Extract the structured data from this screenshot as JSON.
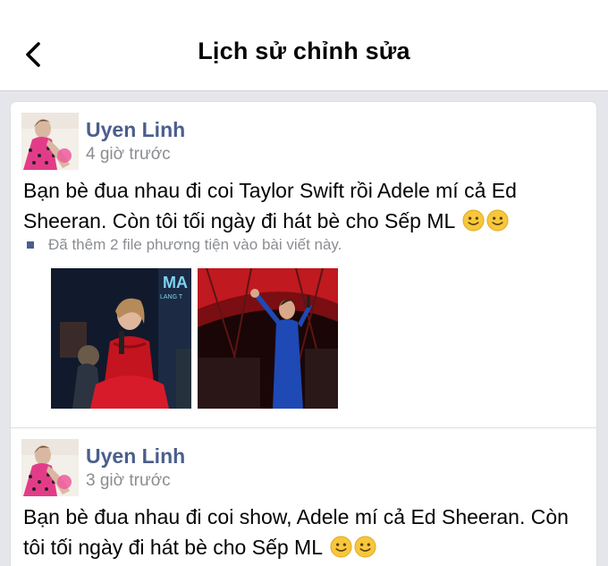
{
  "header": {
    "title": "Lịch sử chỉnh sửa",
    "back_icon": "chevron-left-icon"
  },
  "colors": {
    "author_name": "#4b5e8c",
    "meta_text": "#8a8d91",
    "background": "#e4e6eb"
  },
  "revisions": [
    {
      "author": "Uyen Linh",
      "time": "4 giờ trước",
      "text": "Bạn bè đua nhau đi coi Taylor Swift rồi Adele mí cả Ed Sheeran. Còn tôi tối ngày đi hát bè cho Sếp ML",
      "emojis": [
        "slightly-smiling-face-icon",
        "slightly-smiling-face-icon"
      ],
      "note": "Đã thêm 2 file phương tiện vào bài viết này.",
      "media": [
        {
          "name": "photo-singer-red-dress",
          "overlay_text": "MA",
          "overlay_subtext": "LANG T"
        },
        {
          "name": "photo-singer-blue-dress"
        }
      ]
    },
    {
      "author": "Uyen Linh",
      "time": "3 giờ trước",
      "text": "Bạn bè đua nhau đi coi show, Adele mí cả Ed Sheeran. Còn tôi tối ngày đi hát bè cho Sếp ML",
      "emojis": [
        "slightly-smiling-face-icon",
        "slightly-smiling-face-icon"
      ]
    }
  ]
}
